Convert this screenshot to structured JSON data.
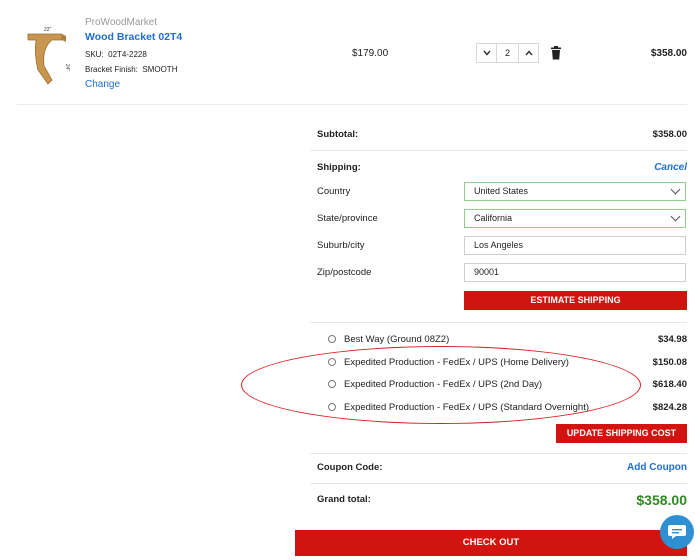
{
  "item": {
    "brand": "ProWoodMarket",
    "name": "Wood Bracket 02T4",
    "sku_label": "SKU:",
    "sku": "02T4-2228",
    "finish_label": "Bracket Finish:",
    "finish": "SMOOTH",
    "change_label": "Change",
    "price": "$179.00",
    "quantity": "2",
    "line_total": "$358.00",
    "thumb_dim_top": "22\"",
    "thumb_dim_side": "24\""
  },
  "summary": {
    "subtotal_label": "Subtotal:",
    "subtotal": "$358.00",
    "shipping_label": "Shipping:",
    "cancel_label": "Cancel",
    "country_label": "Country",
    "country": "United States",
    "state_label": "State/province",
    "state": "California",
    "city_label": "Suburb/city",
    "city": "Los Angeles",
    "zip_label": "Zip/postcode",
    "zip": "90001",
    "estimate_label": "ESTIMATE SHIPPING",
    "options": [
      {
        "name": "Best Way (Ground 08Z2)",
        "price": "$34.98"
      },
      {
        "name": "Expedited Production - FedEx / UPS (Home Delivery)",
        "price": "$150.08"
      },
      {
        "name": "Expedited Production - FedEx / UPS (2nd Day)",
        "price": "$618.40"
      },
      {
        "name": "Expedited Production - FedEx / UPS (Standard Overnight)",
        "price": "$824.28"
      }
    ],
    "update_label": "UPDATE SHIPPING COST",
    "coupon_label": "Coupon Code:",
    "add_coupon_label": "Add Coupon",
    "grand_label": "Grand total:",
    "grand_total": "$358.00",
    "checkout_label": "CHECK OUT"
  },
  "colors": {
    "link": "#1f6fd1",
    "button_red": "#d1140f",
    "grand_total_green": "#2e8b22",
    "annotation_red": "#d81f1f",
    "chat_blue": "#2f8fd3"
  },
  "icons": [
    "chevron-down-icon",
    "chevron-up-icon",
    "trash-icon",
    "chat-icon"
  ]
}
